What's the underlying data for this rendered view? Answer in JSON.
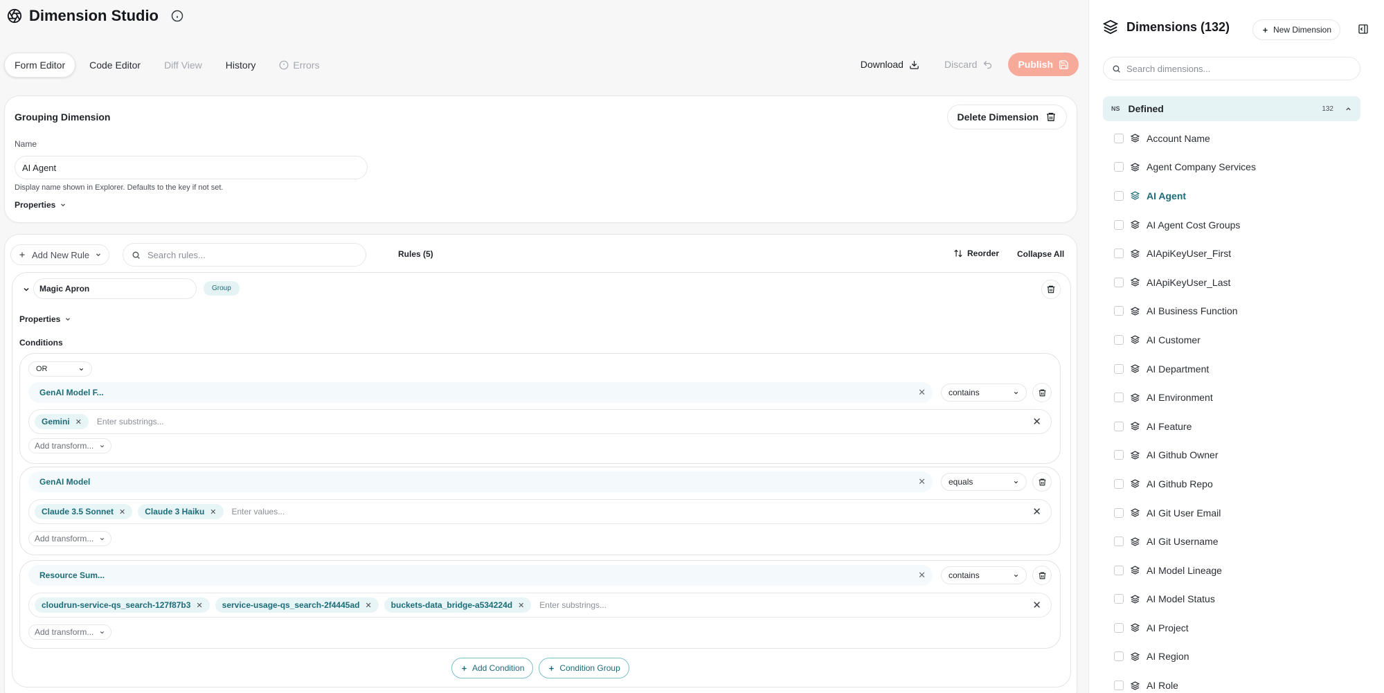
{
  "app": {
    "title": "Dimension Studio"
  },
  "tabs": [
    {
      "label": "Form Editor",
      "state": "active"
    },
    {
      "label": "Code Editor",
      "state": "normal"
    },
    {
      "label": "Diff View",
      "state": "disabled"
    },
    {
      "label": "History",
      "state": "normal"
    },
    {
      "label": "Errors",
      "state": "disabled",
      "icon": "alert-circle-icon"
    }
  ],
  "toolbar": {
    "download_label": "Download",
    "discard_label": "Discard",
    "publish_label": "Publish"
  },
  "grouping_card": {
    "title": "Grouping Dimension",
    "delete_label": "Delete Dimension",
    "name_label": "Name",
    "name_value": "AI Agent",
    "name_help": "Display name shown in Explorer. Defaults to the key if not set.",
    "properties_label": "Properties"
  },
  "rules_bar": {
    "add_rule_label": "Add New Rule",
    "search_placeholder": "Search rules...",
    "rules_count_label": "Rules (5)",
    "reorder_label": "Reorder",
    "collapse_all_label": "Collapse All"
  },
  "rule": {
    "name": "Magic Apron",
    "badge": "Group",
    "properties_label": "Properties",
    "conditions_label": "Conditions",
    "logic_operator": "OR",
    "conditions": [
      {
        "field": "GenAI Model F...",
        "operator": "contains",
        "values": [
          "Gemini"
        ],
        "placeholder": "Enter substrings...",
        "transform_label": "Add transform..."
      },
      {
        "field": "GenAI Model",
        "operator": "equals",
        "values": [
          "Claude 3.5 Sonnet",
          "Claude 3 Haiku"
        ],
        "placeholder": "Enter values...",
        "transform_label": "Add transform..."
      },
      {
        "field": "Resource Sum...",
        "operator": "contains",
        "values": [
          "cloudrun-service-qs_search-127f87b3",
          "service-usage-qs_search-2f4445ad",
          "buckets-data_bridge-a534224d"
        ],
        "placeholder": "Enter substrings...",
        "transform_label": "Add transform..."
      }
    ],
    "add_condition_label": "Add Condition",
    "condition_group_label": "Condition Group"
  },
  "sidebar": {
    "title": "Dimensions (132)",
    "new_label": "New Dimension",
    "search_placeholder": "Search dimensions...",
    "group": {
      "ns": "NS",
      "name": "Defined",
      "count": "132"
    },
    "items": [
      {
        "label": "Account Name"
      },
      {
        "label": "Agent Company Services"
      },
      {
        "label": "AI Agent",
        "active": true
      },
      {
        "label": "AI Agent Cost Groups"
      },
      {
        "label": "AIApiKeyUser_First"
      },
      {
        "label": "AIApiKeyUser_Last"
      },
      {
        "label": "AI Business Function"
      },
      {
        "label": "AI Customer"
      },
      {
        "label": "AI Department"
      },
      {
        "label": "AI Environment"
      },
      {
        "label": "AI Feature"
      },
      {
        "label": "AI Github Owner"
      },
      {
        "label": "AI Github Repo"
      },
      {
        "label": "AI Git User Email"
      },
      {
        "label": "AI Git Username"
      },
      {
        "label": "AI Model Lineage"
      },
      {
        "label": "AI Model Status"
      },
      {
        "label": "AI Project"
      },
      {
        "label": "AI Region"
      },
      {
        "label": "AI Role"
      }
    ]
  },
  "colors": {
    "accent_teal": "#1b6b78",
    "publish_bg": "#f7a99a",
    "chip_bg": "#e8f5f6"
  }
}
